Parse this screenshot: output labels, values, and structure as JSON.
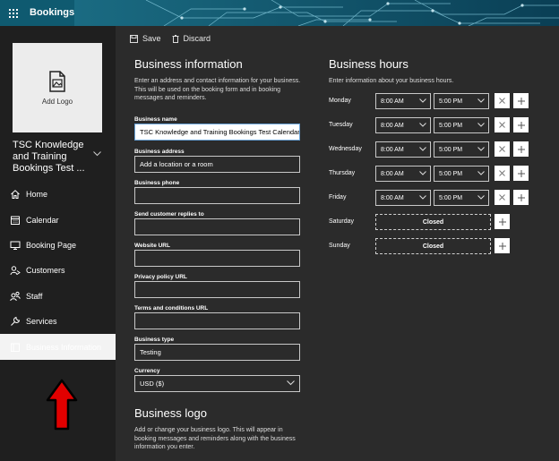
{
  "app": {
    "title": "Bookings"
  },
  "sidebar": {
    "add_logo_label": "Add Logo",
    "business_name": "TSC Knowledge and Training Bookings Test ...",
    "items": [
      {
        "label": "Home",
        "icon": "home-icon"
      },
      {
        "label": "Calendar",
        "icon": "calendar-icon"
      },
      {
        "label": "Booking Page",
        "icon": "monitor-icon"
      },
      {
        "label": "Customers",
        "icon": "customers-icon"
      },
      {
        "label": "Staff",
        "icon": "staff-icon"
      },
      {
        "label": "Services",
        "icon": "wrench-icon"
      },
      {
        "label": "Business Information",
        "icon": "building-icon",
        "active": true
      }
    ]
  },
  "toolbar": {
    "save_label": "Save",
    "discard_label": "Discard"
  },
  "business_info": {
    "title": "Business information",
    "description": "Enter an address and contact information for your business. This will be used on the booking form and in booking messages and reminders.",
    "fields": {
      "name": {
        "label": "Business name",
        "value": "TSC Knowledge and Training Bookings Test Calendar"
      },
      "address": {
        "label": "Business address",
        "placeholder": "Add a location or a room"
      },
      "phone": {
        "label": "Business phone",
        "value": ""
      },
      "replies": {
        "label": "Send customer replies to",
        "value": ""
      },
      "website": {
        "label": "Website URL",
        "value": ""
      },
      "privacy": {
        "label": "Privacy policy URL",
        "value": ""
      },
      "terms": {
        "label": "Terms and conditions URL",
        "value": ""
      },
      "type": {
        "label": "Business type",
        "value": "Testing"
      },
      "currency": {
        "label": "Currency",
        "value": "USD ($)"
      }
    }
  },
  "business_logo": {
    "title": "Business logo",
    "description": "Add or change your business logo. This will appear in booking messages and reminders along with the business information you enter."
  },
  "business_hours": {
    "title": "Business hours",
    "description": "Enter information about your business hours.",
    "days": [
      {
        "day": "Monday",
        "start": "8:00 AM",
        "end": "5:00 PM"
      },
      {
        "day": "Tuesday",
        "start": "8:00 AM",
        "end": "5:00 PM"
      },
      {
        "day": "Wednesday",
        "start": "8:00 AM",
        "end": "5:00 PM"
      },
      {
        "day": "Thursday",
        "start": "8:00 AM",
        "end": "5:00 PM"
      },
      {
        "day": "Friday",
        "start": "8:00 AM",
        "end": "5:00 PM"
      },
      {
        "day": "Saturday",
        "closed": "Closed"
      },
      {
        "day": "Sunday",
        "closed": "Closed"
      }
    ]
  },
  "colors": {
    "topbar": "#0f5a70",
    "sidebar": "#1f1f1f",
    "main": "#2b2b2b",
    "arrow": "#e10000"
  }
}
